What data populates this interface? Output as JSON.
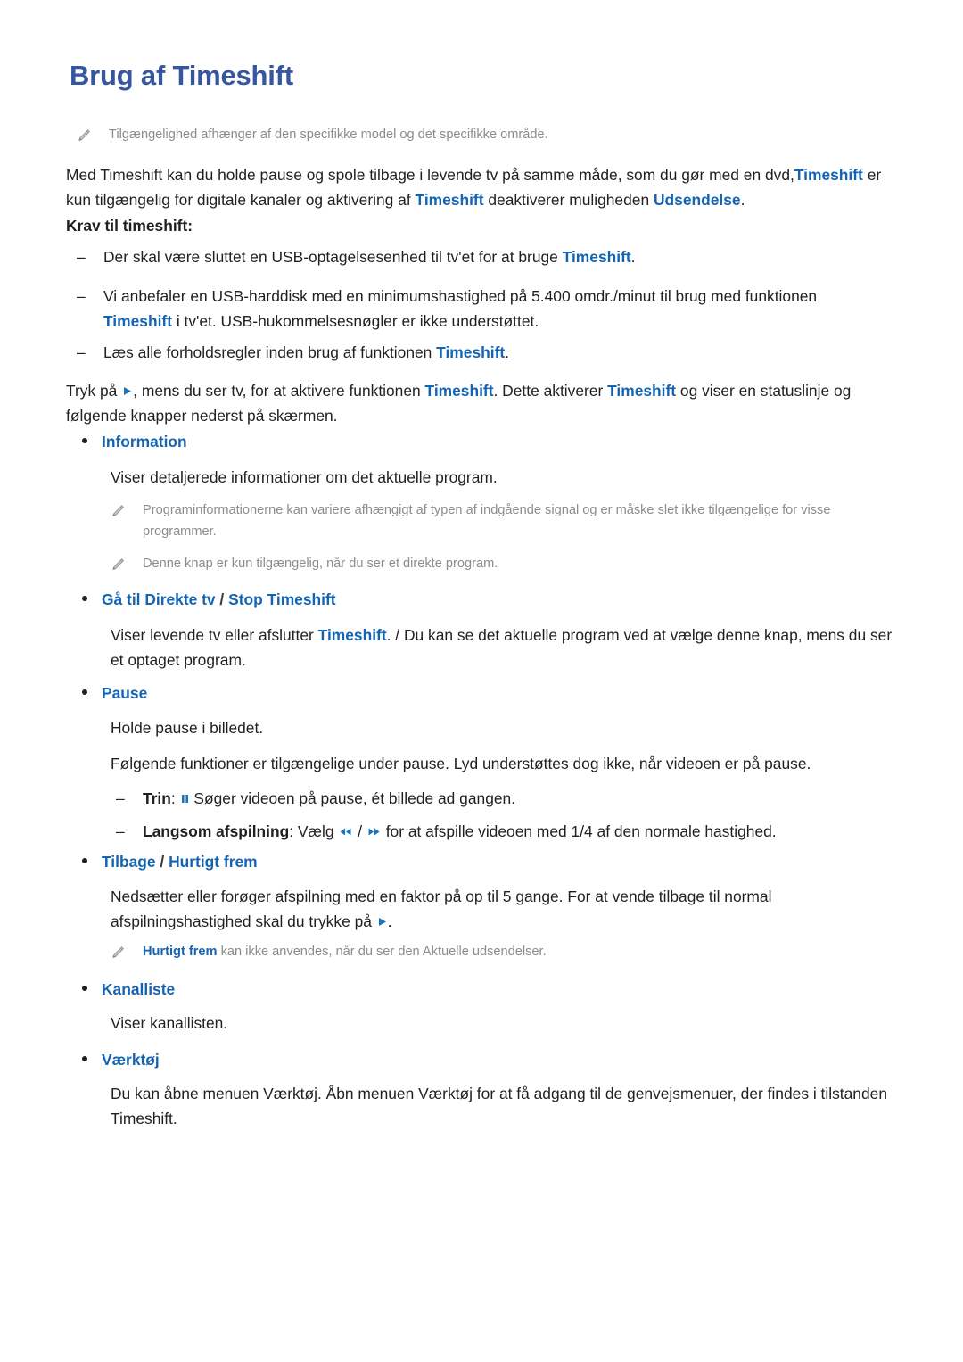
{
  "page": {
    "title": "Brug af Timeshift",
    "accent_heading_color": "#36569f",
    "accent_link_color": "#1464b4",
    "note_color": "#8c8c8c",
    "body_color": "#231f20"
  },
  "top_note": {
    "icon": "pencil-note-icon",
    "text": "Tilgængelighed afhænger af den specifikke model og det specifikke område."
  },
  "intro": {
    "line1_a": "Med Timeshift kan du holde pause og spole tilbage i levende tv på samme måde, som du gør med en dvd,",
    "link1": "Timeshift",
    "line2_a": "er kun tilgængelig for digitale kanaler og aktivering af ",
    "link2": "Timeshift",
    "line2_b": " deaktiverer muligheden ",
    "link3": "Udsendelse",
    "line2_c": "."
  },
  "requirements_heading": "Krav til timeshift:",
  "requirements": [
    {
      "dash": "–",
      "text_a": "Der skal være sluttet en USB-optagelsesenhed til tv'et for at bruge ",
      "link": "Timeshift",
      "text_b": "."
    },
    {
      "dash": "–",
      "text_a": "Vi anbefaler en USB-harddisk med en minimumshastighed på 5.400 omdr./minut til brug med funktionen ",
      "link": "Timeshift",
      "text_b": " i tv'et. USB-hukommelsesnøgler er ikke understøttet."
    },
    {
      "dash": "–",
      "text_a": "Læs alle forholdsregler inden brug af funktionen ",
      "link": "Timeshift",
      "text_b": "."
    }
  ],
  "activation": {
    "text_a": "Tryk på ",
    "icon": "play-icon",
    "text_b": ", mens du ser tv, for at aktivere funktionen ",
    "link1": "Timeshift",
    "text_c": ". Dette aktiverer ",
    "link2": "Timeshift",
    "text_d": " og viser en statuslinje og følgende knapper nederst på skærmen."
  },
  "sections": [
    {
      "name": "information",
      "bullet": "•",
      "label": "Information",
      "body": "Viser detaljerede informationer om det aktuelle program.",
      "notes": [
        "Programinformationerne kan variere afhængigt af typen af indgående signal og er måske slet ikke tilgængelige for visse programmer.",
        "Denne knap er kun tilgængelig, når du ser et direkte program."
      ]
    },
    {
      "name": "go-to-live-tv-stop-timeshift",
      "bullet": "•",
      "label_a": "Gå til Direkte tv",
      "separator": "/",
      "label_b": "Stop Timeshift",
      "body_a": "Viser levende tv eller afslutter ",
      "body_link": "Timeshift",
      "body_b": ". / Du kan se det aktuelle program ved at vælge denne knap, mens du ser et optaget program."
    },
    {
      "name": "pause",
      "bullet": "•",
      "label": "Pause",
      "body": "Holde pause i billedet.",
      "body2": "Følgende funktioner er tilgængelige under pause. Lyd understøttes dog ikke, når videoen er på pause.",
      "sub_items": [
        {
          "dash": "–",
          "bold": "Trin",
          "after_bold": ": ",
          "icon": "pause-icon",
          "text": " Søger videoen på pause, ét billede ad gangen."
        },
        {
          "dash": "–",
          "bold": "Langsom afspilning",
          "after_bold": ": Vælg ",
          "icon_a": "rewind-icon",
          "slash": " / ",
          "icon_b": "fast-forward-icon",
          "text": " for at afspille videoen med 1/4 af den normale hastighed."
        }
      ]
    },
    {
      "name": "rewind-fast-forward",
      "bullet": "•",
      "label_a": "Tilbage",
      "separator": "/",
      "label_b": "Hurtigt frem",
      "body_a": "Nedsætter eller forøger afspilning med en faktor på op til 5 gange. For at vende tilbage til normal afspilningshastighed skal du trykke på ",
      "body_icon": "play-icon",
      "body_b": ".",
      "note_link": "Hurtigt frem",
      "note_text": " kan ikke anvendes, når du ser den Aktuelle udsendelser."
    },
    {
      "name": "kanalliste",
      "bullet": "•",
      "label": "Kanalliste",
      "body": "Viser kanallisten."
    },
    {
      "name": "vaerktoej",
      "bullet": "•",
      "label": "Værktøj",
      "body": "Du kan åbne menuen Værktøj. Åbn menuen Værktøj for at få adgang til de genvejsmenuer, der findes i tilstanden Timeshift."
    }
  ]
}
